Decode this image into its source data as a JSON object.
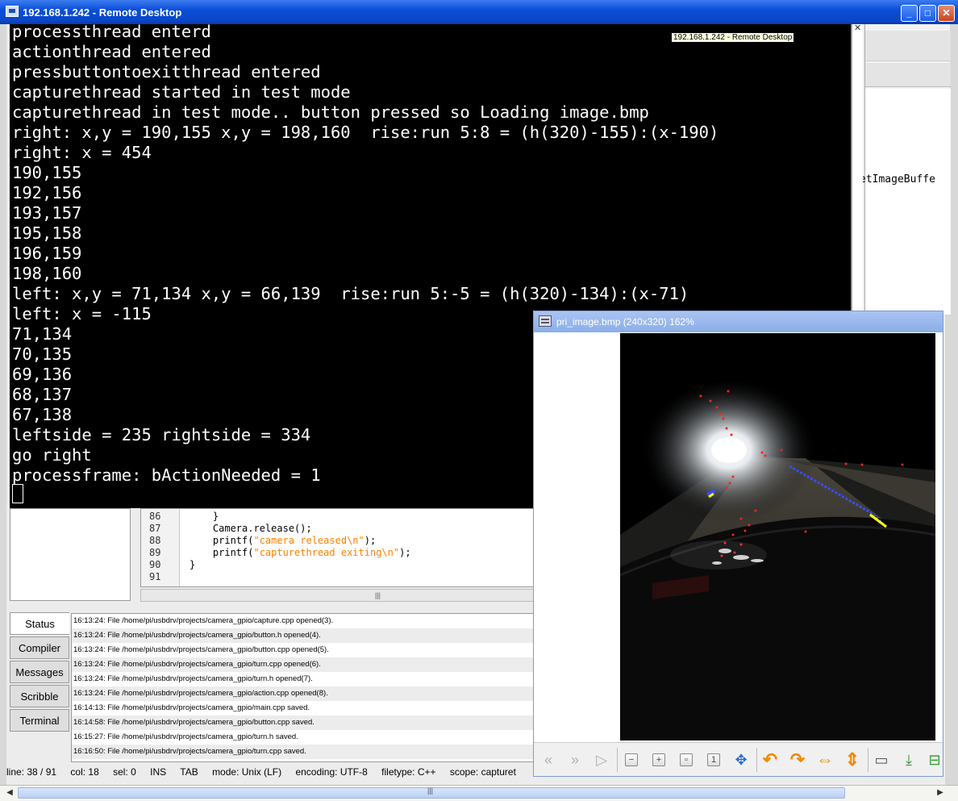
{
  "window": {
    "title": "192.168.1.242 - Remote Desktop",
    "minimize": "_",
    "maximize": "□",
    "close": "✕"
  },
  "ide": {
    "tooltip": "192.168.1.242 - Remote Desktop",
    "symbol_fragment": "etImageBuffe",
    "code_lines": [
      {
        "num": "86",
        "text": "    }"
      },
      {
        "num": "87",
        "text": "    Camera.release();"
      },
      {
        "num": "88",
        "pre": "    printf(",
        "str": "\"camera released\\n\"",
        "post": ");"
      },
      {
        "num": "89",
        "pre": "    printf(",
        "str": "\"capturethread exiting\\n\"",
        "post": ");"
      },
      {
        "num": "90",
        "text": "}"
      },
      {
        "num": "91",
        "text": ""
      }
    ],
    "msg_tabs": [
      "Status",
      "Compiler",
      "Messages",
      "Scribble",
      "Terminal"
    ],
    "messages": [
      "16:13:24: File /home/pi/usbdrv/projects/camera_gpio/capture.cpp opened(3).",
      "16:13:24: File /home/pi/usbdrv/projects/camera_gpio/button.h opened(4).",
      "16:13:24: File /home/pi/usbdrv/projects/camera_gpio/button.cpp opened(5).",
      "16:13:24: File /home/pi/usbdrv/projects/camera_gpio/turn.cpp opened(6).",
      "16:13:24: File /home/pi/usbdrv/projects/camera_gpio/turn.h opened(7).",
      "16:13:24: File /home/pi/usbdrv/projects/camera_gpio/action.cpp opened(8).",
      "16:14:13: File /home/pi/usbdrv/projects/camera_gpio/main.cpp saved.",
      "16:14:58: File /home/pi/usbdrv/projects/camera_gpio/button.cpp saved.",
      "16:15:27: File /home/pi/usbdrv/projects/camera_gpio/turn.h saved.",
      "16:16:50: File /home/pi/usbdrv/projects/camera_gpio/turn.cpp saved."
    ],
    "status": {
      "line": "line: 38 / 91",
      "col": "col: 18",
      "sel": "sel: 0",
      "ins": "INS",
      "tab": "TAB",
      "mode": "mode: Unix (LF)",
      "encoding": "encoding: UTF-8",
      "filetype": "filetype: C++",
      "scope": "scope: capturet"
    }
  },
  "terminal": {
    "lines": [
      "processthread enterd",
      "actionthread entered",
      "pressbuttontoexitthread entered",
      "capturethread started in test mode",
      "capturethread in test mode.. button pressed so Loading image.bmp",
      "right: x,y = 190,155 x,y = 198,160  rise:run 5:8 = (h(320)-155):(x-190)",
      "right: x = 454",
      "190,155",
      "192,156",
      "193,157",
      "195,158",
      "196,159",
      "198,160",
      "left: x,y = 71,134 x,y = 66,139  rise:run 5:-5 = (h(320)-134):(x-71)",
      "left: x = -115",
      "71,134",
      "70,135",
      "69,136",
      "68,137",
      "67,138",
      "leftside = 235 rightside = 334",
      "go right",
      "processframe: bActionNeeded = 1"
    ]
  },
  "viewer": {
    "title": "pri_image.bmp (240x320) 162%",
    "toolbar_icons": [
      "back-icon",
      "forward-icon",
      "play-icon",
      "zoom-out-icon",
      "zoom-in-icon",
      "zoom-fit-icon",
      "zoom-original-icon",
      "fullscreen-icon",
      "rotate-left-icon",
      "rotate-right-icon",
      "flip-horizontal-icon",
      "flip-vertical-icon",
      "open-folder-icon",
      "save-icon",
      "delete-icon"
    ]
  },
  "colors": {
    "titlebar": "#0a46c8",
    "terminal_bg": "#000000",
    "string_literal": "#ff7f00",
    "lane_marker_blue": "#3a4cff",
    "lane_marker_yellow": "#ffff00",
    "detection_red": "#ff2020"
  }
}
